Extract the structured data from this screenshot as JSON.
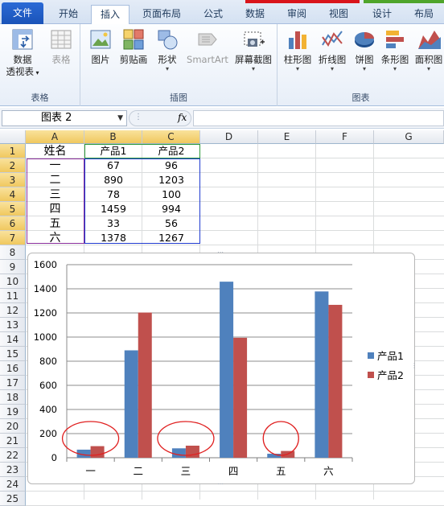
{
  "ribbon": {
    "tabs": [
      "文件",
      "开始",
      "插入",
      "页面布局",
      "公式",
      "数据",
      "审阅",
      "视图",
      "设计",
      "布局"
    ],
    "groups": {
      "tables": {
        "label": "表格",
        "pivot_line1": "数据",
        "pivot_line2": "透视表",
        "table": "表格"
      },
      "illustrations": {
        "label": "插图",
        "picture": "图片",
        "clipart": "剪贴画",
        "shapes": "形状",
        "smartart": "SmartArt",
        "screenshot": "屏幕截图"
      },
      "charts": {
        "label": "图表",
        "column": "柱形图",
        "line": "折线图",
        "pie": "饼图",
        "bar": "条形图",
        "area": "面积图"
      }
    }
  },
  "formula_bar": {
    "name_box": "图表 2",
    "fx": "fx",
    "formula": ""
  },
  "grid": {
    "columns": [
      "A",
      "B",
      "C",
      "D",
      "E",
      "F",
      "G"
    ],
    "rows": [
      "1",
      "2",
      "3",
      "4",
      "5",
      "6",
      "7",
      "8",
      "9",
      "10",
      "11",
      "12",
      "13",
      "14",
      "15",
      "16",
      "17",
      "18",
      "19",
      "20",
      "21",
      "22",
      "23",
      "24",
      "25"
    ],
    "cells": [
      [
        "姓名",
        "产品1",
        "产品2"
      ],
      [
        "一",
        "67",
        "96"
      ],
      [
        "二",
        "890",
        "1203"
      ],
      [
        "三",
        "78",
        "100"
      ],
      [
        "四",
        "1459",
        "994"
      ],
      [
        "五",
        "33",
        "56"
      ],
      [
        "六",
        "1378",
        "1267"
      ]
    ]
  },
  "chart_data": {
    "type": "bar",
    "categories": [
      "一",
      "二",
      "三",
      "四",
      "五",
      "六"
    ],
    "series": [
      {
        "name": "产品1",
        "values": [
          67,
          890,
          78,
          1459,
          33,
          1378
        ],
        "color": "#4f81bd"
      },
      {
        "name": "产品2",
        "values": [
          96,
          1203,
          100,
          994,
          56,
          1267
        ],
        "color": "#c0504d"
      }
    ],
    "ylim": [
      0,
      1600
    ],
    "yticks": [
      "0",
      "200",
      "400",
      "600",
      "800",
      "1000",
      "1200",
      "1400",
      "1600"
    ],
    "grid": true,
    "legend": "right",
    "annotations": {
      "circled_categories": [
        "一",
        "三",
        "五"
      ],
      "circle_color": "#e02020"
    }
  }
}
